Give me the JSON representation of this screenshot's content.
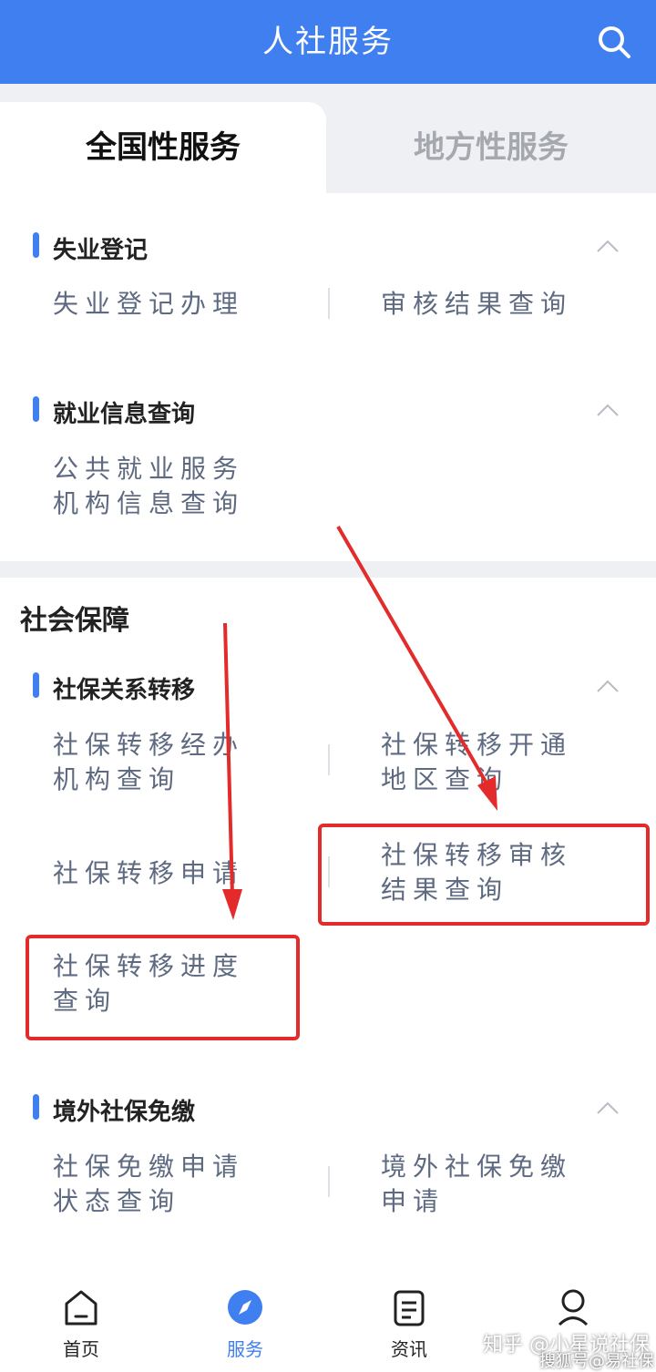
{
  "header": {
    "title": "人社服务"
  },
  "tabs": [
    {
      "label": "全国性服务",
      "active": true
    },
    {
      "label": "地方性服务",
      "active": false
    }
  ],
  "groups": {
    "unemployment": {
      "title": "失业登记",
      "items": [
        "失业登记办理",
        "审核结果查询"
      ]
    },
    "employment_info": {
      "title": "就业信息查询",
      "items": [
        "公共就业服务\n机构信息查询"
      ]
    },
    "transfer": {
      "title": "社保关系转移",
      "items": [
        "社保转移经办\n机构查询",
        "社保转移开通\n地区查询",
        "社保转移申请",
        "社保转移审核\n结果查询",
        "社保转移进度\n查询"
      ]
    },
    "exemption": {
      "title": "境外社保免缴",
      "items": [
        "社保免缴申请\n状态查询",
        "境外社保免缴\n申请"
      ]
    }
  },
  "section": {
    "social_security": "社会保障"
  },
  "bottom_nav": [
    {
      "label": "首页",
      "icon": "home-icon",
      "active": false
    },
    {
      "label": "服务",
      "icon": "service-compass-icon",
      "active": true
    },
    {
      "label": "资讯",
      "icon": "news-icon",
      "active": false
    },
    {
      "label": "",
      "icon": "profile-icon",
      "active": false
    }
  ],
  "watermark": {
    "line1": "知乎 @小星说社保",
    "line2": "搜狐号@易社保"
  },
  "colors": {
    "primary": "#3f7ff0",
    "highlight": "#e32b2b",
    "service_text": "#5e6a81"
  }
}
